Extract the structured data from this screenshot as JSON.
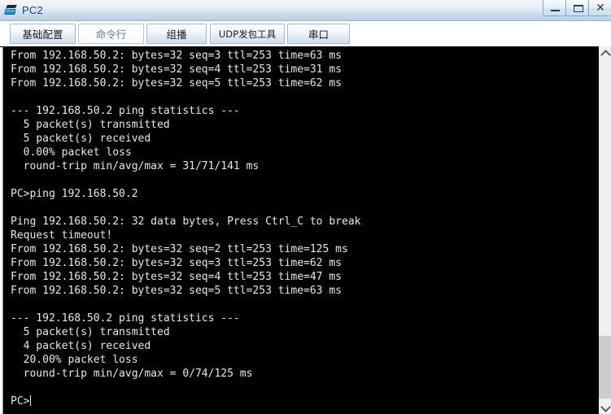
{
  "window": {
    "title": "PC2",
    "icon": "network-pc-icon",
    "controls": {
      "minimize_label": "—",
      "maximize_label": "▭",
      "close_label": "✕"
    }
  },
  "tabs": [
    {
      "label": "基础配置",
      "name": "tab-basic-config",
      "active": false
    },
    {
      "label": "命令行",
      "name": "tab-command-line",
      "active": true
    },
    {
      "label": "组播",
      "name": "tab-multicast",
      "active": false
    },
    {
      "label": "UDP发包工具",
      "name": "tab-udp-tool",
      "active": false
    },
    {
      "label": "串口",
      "name": "tab-serial-port",
      "active": false
    }
  ],
  "terminal": {
    "foreground": "#e8e8e8",
    "background": "#000000",
    "lines": [
      "From 192.168.50.2: bytes=32 seq=3 ttl=253 time=63 ms",
      "From 192.168.50.2: bytes=32 seq=4 ttl=253 time=31 ms",
      "From 192.168.50.2: bytes=32 seq=5 ttl=253 time=62 ms",
      "",
      "--- 192.168.50.2 ping statistics ---",
      "  5 packet(s) transmitted",
      "  5 packet(s) received",
      "  0.00% packet loss",
      "  round-trip min/avg/max = 31/71/141 ms",
      "",
      "PC>ping 192.168.50.2",
      "",
      "Ping 192.168.50.2: 32 data bytes, Press Ctrl_C to break",
      "Request timeout!",
      "From 192.168.50.2: bytes=32 seq=2 ttl=253 time=125 ms",
      "From 192.168.50.2: bytes=32 seq=3 ttl=253 time=62 ms",
      "From 192.168.50.2: bytes=32 seq=4 ttl=253 time=47 ms",
      "From 192.168.50.2: bytes=32 seq=5 ttl=253 time=63 ms",
      "",
      "--- 192.168.50.2 ping statistics ---",
      "  5 packet(s) transmitted",
      "  4 packet(s) received",
      "  20.00% packet loss",
      "  round-trip min/avg/max = 0/74/125 ms",
      "",
      "PC>"
    ],
    "prompt": "PC>"
  },
  "scrollbar": {
    "up_arrow": "scroll-up-arrow",
    "down_arrow": "scroll-down-arrow",
    "thumb": "scroll-thumb"
  }
}
